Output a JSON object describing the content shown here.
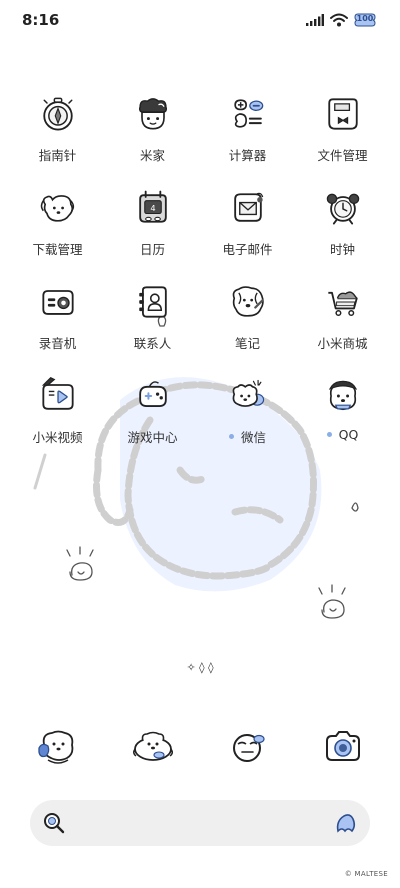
{
  "status_bar": {
    "time": "8:16",
    "battery": "100"
  },
  "apps": [
    {
      "label": "指南针",
      "icon": "compass-icon",
      "dot": false
    },
    {
      "label": "米家",
      "icon": "mijia-icon",
      "dot": false
    },
    {
      "label": "计算器",
      "icon": "calculator-icon",
      "dot": false
    },
    {
      "label": "文件管理",
      "icon": "file-manager-icon",
      "dot": false
    },
    {
      "label": "下载管理",
      "icon": "download-icon",
      "dot": false
    },
    {
      "label": "日历",
      "icon": "calendar-icon",
      "dot": false
    },
    {
      "label": "电子邮件",
      "icon": "email-icon",
      "dot": false
    },
    {
      "label": "时钟",
      "icon": "clock-icon",
      "dot": false
    },
    {
      "label": "录音机",
      "icon": "recorder-icon",
      "dot": false
    },
    {
      "label": "联系人",
      "icon": "contacts-icon",
      "dot": false
    },
    {
      "label": "笔记",
      "icon": "notes-icon",
      "dot": false
    },
    {
      "label": "小米商城",
      "icon": "mi-store-icon",
      "dot": false
    },
    {
      "label": "小米视频",
      "icon": "mi-video-icon",
      "dot": false
    },
    {
      "label": "游戏中心",
      "icon": "game-center-icon",
      "dot": false
    },
    {
      "label": "微信",
      "icon": "wechat-icon",
      "dot": true
    },
    {
      "label": "QQ",
      "icon": "qq-icon",
      "dot": true
    }
  ],
  "calendar_day": "4",
  "dock": [
    {
      "icon": "phone-icon"
    },
    {
      "icon": "messages-icon"
    },
    {
      "icon": "browser-icon"
    },
    {
      "icon": "camera-icon"
    }
  ],
  "page_indicator": "✧ ◊ ◊",
  "search": {
    "icon": "search-icon",
    "assistant_icon": "assistant-icon"
  },
  "watermark": "© MALTESE",
  "colors": {
    "accent_blue": "#a9c4f2",
    "line": "#2b2b2b",
    "background": "#ffffff"
  }
}
